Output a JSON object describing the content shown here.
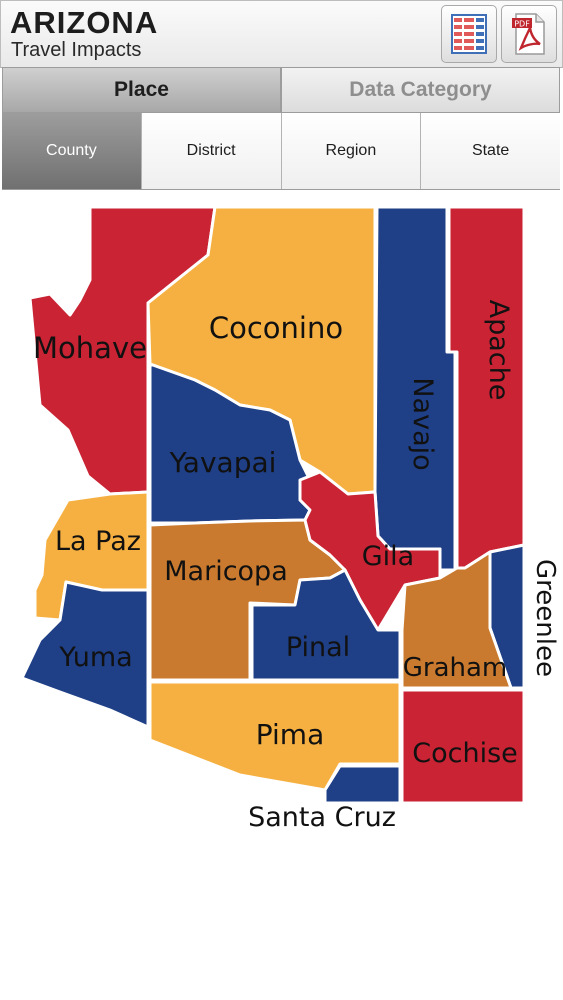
{
  "header": {
    "brand": "ARIZONA",
    "subtitle": "Travel Impacts",
    "table_icon": "table-icon",
    "pdf_icon": "pdf-icon",
    "pdf_label": "PDF"
  },
  "main_tabs": [
    {
      "label": "Place",
      "active": true
    },
    {
      "label": "Data Category",
      "active": false
    }
  ],
  "place_tabs": [
    {
      "label": "County",
      "active": true
    },
    {
      "label": "District",
      "active": false
    },
    {
      "label": "Region",
      "active": false
    },
    {
      "label": "State",
      "active": false
    }
  ],
  "colors": {
    "red": "#c92334",
    "gold": "#f5b041",
    "navy": "#1f3f86",
    "brown": "#c97a2e"
  },
  "map": {
    "counties": {
      "mohave": "Mohave",
      "coconino": "Coconino",
      "navajo": "Navajo",
      "apache": "Apache",
      "yavapai": "Yavapai",
      "lapaz": "La Paz",
      "maricopa": "Maricopa",
      "gila": "Gila",
      "greenlee": "Greenlee",
      "yuma": "Yuma",
      "pinal": "Pinal",
      "graham": "Graham",
      "pima": "Pima",
      "cochise": "Cochise",
      "santacruz": "Santa Cruz"
    }
  }
}
